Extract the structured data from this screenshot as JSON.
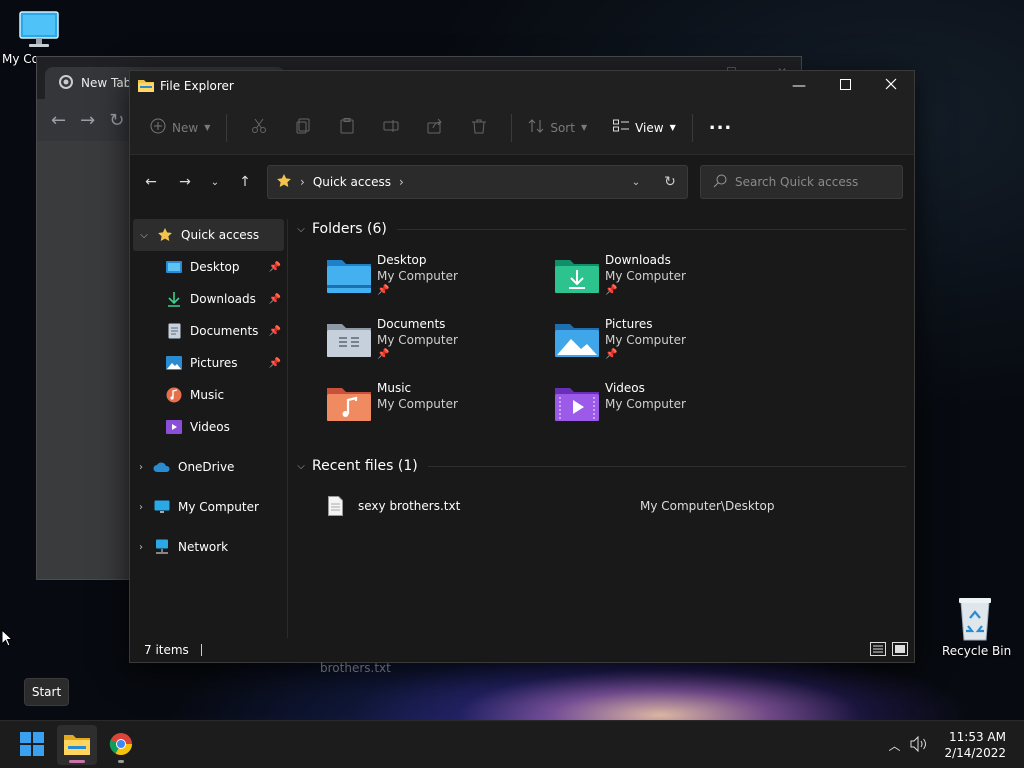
{
  "desktop": {
    "icons": [
      {
        "label": "My Co",
        "icon": "monitor-icon"
      },
      {
        "label": "Recycle Bin",
        "icon": "recycle-bin-icon"
      }
    ]
  },
  "chrome": {
    "tab_title": "New Tab"
  },
  "explorer": {
    "title": "File Explorer",
    "command_bar": {
      "new_label": "New",
      "sort_label": "Sort",
      "view_label": "View",
      "more_label": "..."
    },
    "address": {
      "path": "Quick access"
    },
    "search": {
      "placeholder": "Search Quick access"
    },
    "sidebar": {
      "quick_access": "Quick access",
      "items": [
        {
          "label": "Desktop",
          "pinned": true
        },
        {
          "label": "Downloads",
          "pinned": true
        },
        {
          "label": "Documents",
          "pinned": true
        },
        {
          "label": "Pictures",
          "pinned": true
        },
        {
          "label": "Music",
          "pinned": false
        },
        {
          "label": "Videos",
          "pinned": false
        }
      ],
      "onedrive": "OneDrive",
      "my_computer": "My Computer",
      "network": "Network"
    },
    "folders_header": "Folders (6)",
    "folders": [
      {
        "name": "Desktop",
        "location": "My Computer",
        "pinned": true
      },
      {
        "name": "Downloads",
        "location": "My Computer",
        "pinned": true
      },
      {
        "name": "Documents",
        "location": "My Computer",
        "pinned": true
      },
      {
        "name": "Pictures",
        "location": "My Computer",
        "pinned": true
      },
      {
        "name": "Music",
        "location": "My Computer",
        "pinned": false
      },
      {
        "name": "Videos",
        "location": "My Computer",
        "pinned": false
      }
    ],
    "recent_header": "Recent files (1)",
    "recent_files": [
      {
        "name": "sexy brothers.txt",
        "path": "My Computer\\Desktop"
      }
    ],
    "status": {
      "items": "7 items"
    }
  },
  "ghost_label": "brothers.txt",
  "tooltip": {
    "start": "Start"
  },
  "taskbar": {
    "time": "11:53 AM",
    "date": "2/14/2022"
  },
  "colors": {
    "accent": "#0078d4",
    "folder_yellow": "#f3c44d",
    "window_bg": "#191919"
  }
}
